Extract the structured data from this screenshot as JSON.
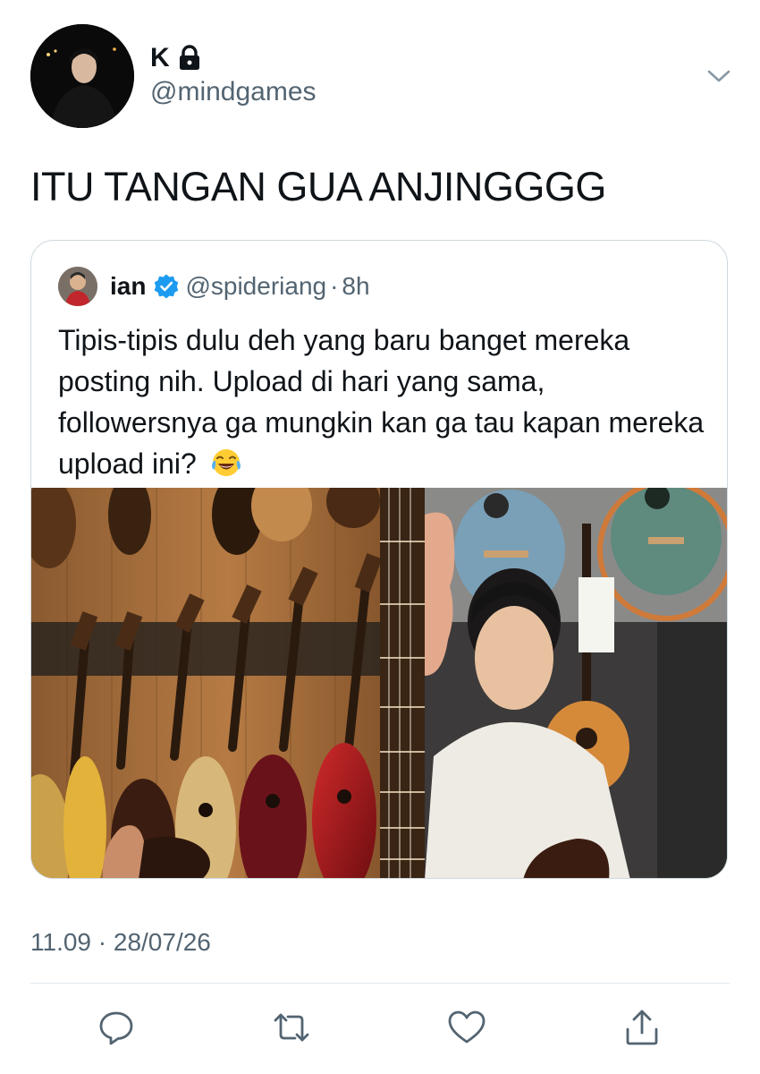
{
  "tweet": {
    "author": {
      "display_name": "K",
      "handle": "@mindgames",
      "protected_icon": "lock-icon",
      "avatar": "profile-photo"
    },
    "text": "ITU TANGAN GUA ANJINGGGG",
    "menu_icon": "chevron-down-icon",
    "timestamp": "11.09 · 28/07/26"
  },
  "quote": {
    "author": {
      "display_name": "ian",
      "verified_icon": "verified-badge-icon",
      "handle": "@spideriang",
      "separator": "·",
      "time": "8h"
    },
    "text": "Tipis-tipis dulu deh yang baru banget mereka posting nih. Upload di hari yang sama, followersnya ga mungkin kan ga tau kapan mereka upload ini?",
    "emoji": "😂",
    "media": [
      {
        "description_icon": "guitar-wall-photo"
      },
      {
        "description_icon": "person-with-guitar-photo"
      }
    ]
  },
  "actions": [
    {
      "name": "reply-icon"
    },
    {
      "name": "retweet-icon"
    },
    {
      "name": "like-icon"
    },
    {
      "name": "share-icon"
    }
  ],
  "colors": {
    "primary_text": "#0f1419",
    "secondary_text": "#536471",
    "border": "#cfd9de",
    "verified_blue": "#1d9bf0"
  }
}
